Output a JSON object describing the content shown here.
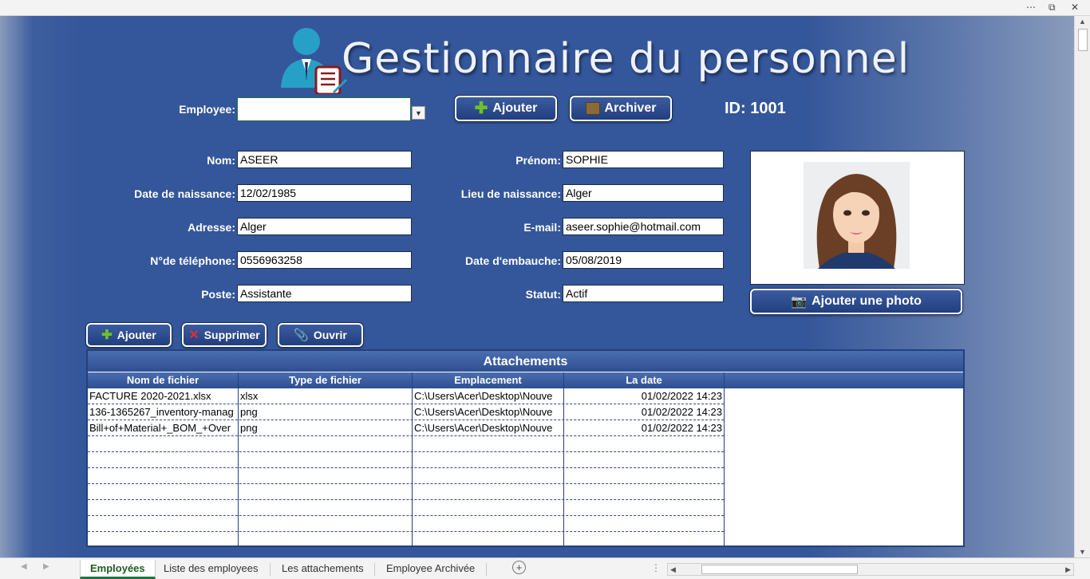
{
  "header": {
    "title": "Gestionnaire du personnel"
  },
  "selector": {
    "label": "Employee:",
    "value": ""
  },
  "actions": {
    "add_label": "Ajouter",
    "archive_label": "Archiver"
  },
  "id": {
    "label": "ID:",
    "value": "1001"
  },
  "form": {
    "nom": {
      "label": "Nom:",
      "value": "ASEER"
    },
    "prenom": {
      "label": "Prénom:",
      "value": "SOPHIE"
    },
    "date_naissance": {
      "label": "Date de naissance:",
      "value": "12/02/1985"
    },
    "lieu_naissance": {
      "label": "Lieu de naissance:",
      "value": "Alger"
    },
    "adresse": {
      "label": "Adresse:",
      "value": "Alger"
    },
    "email": {
      "label": "E-mail:",
      "value": "aseer.sophie@hotmail.com"
    },
    "telephone": {
      "label": "N°de téléphone:",
      "value": "0556963258"
    },
    "date_embauche": {
      "label": "Date d'embauche:",
      "value": "05/08/2019"
    },
    "poste": {
      "label": "Poste:",
      "value": "Assistante"
    },
    "statut": {
      "label": "Statut:",
      "value": "Actif"
    }
  },
  "photo": {
    "button_label": "Ajouter une photo"
  },
  "attachments": {
    "add_label": "Ajouter",
    "delete_label": "Supprimer",
    "open_label": "Ouvrir",
    "title": "Attachements",
    "columns": [
      "Nom de fichier",
      "Type de fichier",
      "Emplacement",
      "La date"
    ],
    "rows": [
      {
        "name": "FACTURE 2020-2021.xlsx",
        "type": "xlsx",
        "location": "C:\\Users\\Acer\\Desktop\\Nouve",
        "date": "01/02/2022 14:23"
      },
      {
        "name": "136-1365267_inventory-manag",
        "type": "png",
        "location": "C:\\Users\\Acer\\Desktop\\Nouve",
        "date": "01/02/2022 14:23"
      },
      {
        "name": "Bill+of+Material+_BOM_+Over",
        "type": "png",
        "location": "C:\\Users\\Acer\\Desktop\\Nouve",
        "date": "01/02/2022 14:23"
      }
    ]
  },
  "sheet_tabs": [
    {
      "label": "Employées",
      "active": true
    },
    {
      "label": "Liste des employees",
      "active": false
    },
    {
      "label": "Les attachements",
      "active": false
    },
    {
      "label": "Employee Archivée",
      "active": false
    }
  ],
  "colors": {
    "accent": "#34569a",
    "header": "#2f4f93",
    "active_tab": "#217346"
  }
}
